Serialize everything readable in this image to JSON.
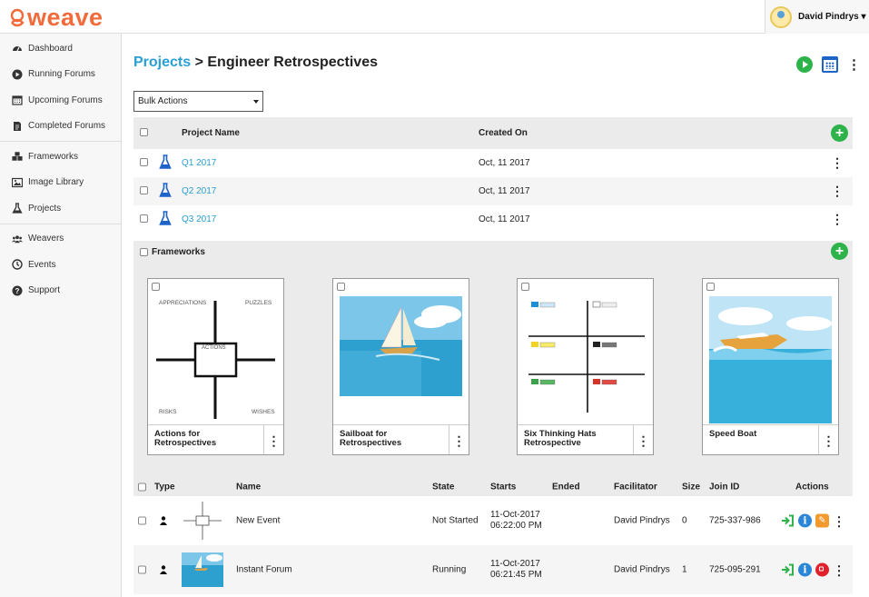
{
  "app": {
    "logo_text": "weave"
  },
  "user": {
    "name": "David Pindrys ▾"
  },
  "sidebar": {
    "groups": [
      [
        {
          "label": "Dashboard",
          "icon": "dashboard-icon"
        },
        {
          "label": "Running Forums",
          "icon": "play-circle-icon"
        },
        {
          "label": "Upcoming Forums",
          "icon": "calendar-icon"
        },
        {
          "label": "Completed Forums",
          "icon": "document-icon"
        }
      ],
      [
        {
          "label": "Frameworks",
          "icon": "cubes-icon"
        },
        {
          "label": "Image Library",
          "icon": "image-icon"
        },
        {
          "label": "Projects",
          "icon": "flask-icon"
        }
      ],
      [
        {
          "label": "Weavers",
          "icon": "users-icon"
        },
        {
          "label": "Events",
          "icon": "clock-icon"
        },
        {
          "label": "Support",
          "icon": "help-icon"
        }
      ]
    ]
  },
  "page": {
    "breadcrumb_root": "Projects",
    "breadcrumb_sep": " > ",
    "title": "Engineer Retrospectives",
    "bulk_actions": "Bulk Actions"
  },
  "projects": {
    "headers": {
      "name": "Project Name",
      "created": "Created On"
    },
    "rows": [
      {
        "name": "Q1 2017",
        "created": "Oct, 11 2017"
      },
      {
        "name": "Q2 2017",
        "created": "Oct, 11 2017"
      },
      {
        "name": "Q3 2017",
        "created": "Oct, 11 2017"
      }
    ]
  },
  "frameworks": {
    "header": "Frameworks",
    "cards": [
      {
        "title": "Actions for Retrospectives",
        "labels": {
          "tl": "APPRECIATIONS",
          "tr": "PUZZLES",
          "c": "ACTIONS",
          "bl": "RISKS",
          "br": "WISHES"
        }
      },
      {
        "title": "Sailboat for Retrospectives"
      },
      {
        "title": "Six Thinking Hats Retrospective"
      },
      {
        "title": "Speed Boat"
      }
    ]
  },
  "events": {
    "headers": {
      "type": "Type",
      "name": "Name",
      "state": "State",
      "starts": "Starts",
      "ended": "Ended",
      "facilitator": "Facilitator",
      "size": "Size",
      "join": "Join ID",
      "actions": "Actions"
    },
    "rows": [
      {
        "name": "New Event",
        "state": "Not Started",
        "starts_date": "11-Oct-2017",
        "starts_time": "06:22:00 PM",
        "ended": "",
        "facilitator": "David Pindrys",
        "size": "0",
        "join": "725-337-986"
      },
      {
        "name": "Instant Forum",
        "state": "Running",
        "starts_date": "11-Oct-2017",
        "starts_time": "06:21:45 PM",
        "ended": "",
        "facilitator": "David Pindrys",
        "size": "1",
        "join": "725-095-291"
      }
    ]
  },
  "colors": {
    "accent": "#2a9fd6",
    "brand": "#f26b3a",
    "green": "#2db34a",
    "red": "#e0202a",
    "orange": "#f29a2e"
  }
}
